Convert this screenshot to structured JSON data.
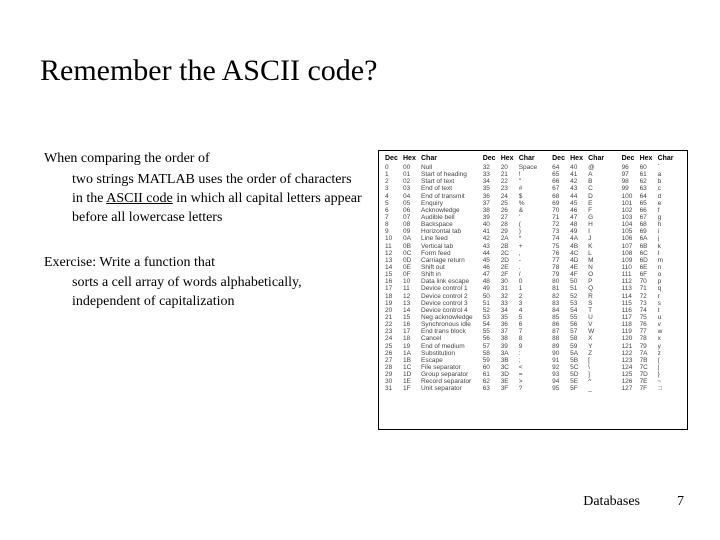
{
  "title": "Remember the ASCII code?",
  "para1": {
    "lead": "When comparing the order of",
    "rest": "two strings MATLAB uses the order of characters in the ",
    "link": "ASCII code",
    "tail": " in which all capital letters appear before all lowercase letters"
  },
  "para2": {
    "lead": "Exercise:  Write a function that",
    "rest": "sorts a cell array of words alphabetically, independent of capitalization"
  },
  "table_headers": [
    "Dec",
    "Hex",
    "Char"
  ],
  "ascii_cols": [
    [
      {
        "d": "0",
        "h": "00",
        "c": "Null"
      },
      {
        "d": "1",
        "h": "01",
        "c": "Start of heading"
      },
      {
        "d": "2",
        "h": "02",
        "c": "Start of text"
      },
      {
        "d": "3",
        "h": "03",
        "c": "End of text"
      },
      {
        "d": "4",
        "h": "04",
        "c": "End of transmit"
      },
      {
        "d": "5",
        "h": "05",
        "c": "Enquiry"
      },
      {
        "d": "6",
        "h": "06",
        "c": "Acknowledge"
      },
      {
        "d": "7",
        "h": "07",
        "c": "Audible bell"
      },
      {
        "d": "8",
        "h": "08",
        "c": "Backspace"
      },
      {
        "d": "9",
        "h": "09",
        "c": "Horizontal tab"
      },
      {
        "d": "10",
        "h": "0A",
        "c": "Line feed"
      },
      {
        "d": "11",
        "h": "0B",
        "c": "Vertical tab"
      },
      {
        "d": "12",
        "h": "0C",
        "c": "Form feed"
      },
      {
        "d": "13",
        "h": "0D",
        "c": "Carriage return"
      },
      {
        "d": "14",
        "h": "0E",
        "c": "Shift out"
      },
      {
        "d": "15",
        "h": "0F",
        "c": "Shift in"
      },
      {
        "d": "16",
        "h": "10",
        "c": "Data link escape"
      },
      {
        "d": "17",
        "h": "11",
        "c": "Device control 1"
      },
      {
        "d": "18",
        "h": "12",
        "c": "Device control 2"
      },
      {
        "d": "19",
        "h": "13",
        "c": "Device control 3"
      },
      {
        "d": "20",
        "h": "14",
        "c": "Device control 4"
      },
      {
        "d": "21",
        "h": "15",
        "c": "Neg acknowledge"
      },
      {
        "d": "22",
        "h": "16",
        "c": "Synchronous idle"
      },
      {
        "d": "23",
        "h": "17",
        "c": "End trans block"
      },
      {
        "d": "24",
        "h": "18",
        "c": "Cancel"
      },
      {
        "d": "25",
        "h": "19",
        "c": "End of medium"
      },
      {
        "d": "26",
        "h": "1A",
        "c": "Substitution"
      },
      {
        "d": "27",
        "h": "1B",
        "c": "Escape"
      },
      {
        "d": "28",
        "h": "1C",
        "c": "File separator"
      },
      {
        "d": "29",
        "h": "1D",
        "c": "Group separator"
      },
      {
        "d": "30",
        "h": "1E",
        "c": "Record separator"
      },
      {
        "d": "31",
        "h": "1F",
        "c": "Unit separator"
      }
    ],
    [
      {
        "d": "32",
        "h": "20",
        "c": "Space"
      },
      {
        "d": "33",
        "h": "21",
        "c": "!"
      },
      {
        "d": "34",
        "h": "22",
        "c": "\""
      },
      {
        "d": "35",
        "h": "23",
        "c": "#"
      },
      {
        "d": "36",
        "h": "24",
        "c": "$"
      },
      {
        "d": "37",
        "h": "25",
        "c": "%"
      },
      {
        "d": "38",
        "h": "26",
        "c": "&"
      },
      {
        "d": "39",
        "h": "27",
        "c": "'"
      },
      {
        "d": "40",
        "h": "28",
        "c": "("
      },
      {
        "d": "41",
        "h": "29",
        "c": ")"
      },
      {
        "d": "42",
        "h": "2A",
        "c": "*"
      },
      {
        "d": "43",
        "h": "2B",
        "c": "+"
      },
      {
        "d": "44",
        "h": "2C",
        "c": ","
      },
      {
        "d": "45",
        "h": "2D",
        "c": "-"
      },
      {
        "d": "46",
        "h": "2E",
        "c": "."
      },
      {
        "d": "47",
        "h": "2F",
        "c": "/"
      },
      {
        "d": "48",
        "h": "30",
        "c": "0"
      },
      {
        "d": "49",
        "h": "31",
        "c": "1"
      },
      {
        "d": "50",
        "h": "32",
        "c": "2"
      },
      {
        "d": "51",
        "h": "33",
        "c": "3"
      },
      {
        "d": "52",
        "h": "34",
        "c": "4"
      },
      {
        "d": "53",
        "h": "35",
        "c": "5"
      },
      {
        "d": "54",
        "h": "36",
        "c": "6"
      },
      {
        "d": "55",
        "h": "37",
        "c": "7"
      },
      {
        "d": "56",
        "h": "38",
        "c": "8"
      },
      {
        "d": "57",
        "h": "39",
        "c": "9"
      },
      {
        "d": "58",
        "h": "3A",
        "c": ":"
      },
      {
        "d": "59",
        "h": "3B",
        "c": ";"
      },
      {
        "d": "60",
        "h": "3C",
        "c": "<"
      },
      {
        "d": "61",
        "h": "3D",
        "c": "="
      },
      {
        "d": "62",
        "h": "3E",
        "c": ">"
      },
      {
        "d": "63",
        "h": "3F",
        "c": "?"
      }
    ],
    [
      {
        "d": "64",
        "h": "40",
        "c": "@"
      },
      {
        "d": "65",
        "h": "41",
        "c": "A"
      },
      {
        "d": "66",
        "h": "42",
        "c": "B"
      },
      {
        "d": "67",
        "h": "43",
        "c": "C"
      },
      {
        "d": "68",
        "h": "44",
        "c": "D"
      },
      {
        "d": "69",
        "h": "45",
        "c": "E"
      },
      {
        "d": "70",
        "h": "46",
        "c": "F"
      },
      {
        "d": "71",
        "h": "47",
        "c": "G"
      },
      {
        "d": "72",
        "h": "48",
        "c": "H"
      },
      {
        "d": "73",
        "h": "49",
        "c": "I"
      },
      {
        "d": "74",
        "h": "4A",
        "c": "J"
      },
      {
        "d": "75",
        "h": "4B",
        "c": "K"
      },
      {
        "d": "76",
        "h": "4C",
        "c": "L"
      },
      {
        "d": "77",
        "h": "4D",
        "c": "M"
      },
      {
        "d": "78",
        "h": "4E",
        "c": "N"
      },
      {
        "d": "79",
        "h": "4F",
        "c": "O"
      },
      {
        "d": "80",
        "h": "50",
        "c": "P"
      },
      {
        "d": "81",
        "h": "51",
        "c": "Q"
      },
      {
        "d": "82",
        "h": "52",
        "c": "R"
      },
      {
        "d": "83",
        "h": "53",
        "c": "S"
      },
      {
        "d": "84",
        "h": "54",
        "c": "T"
      },
      {
        "d": "85",
        "h": "55",
        "c": "U"
      },
      {
        "d": "86",
        "h": "56",
        "c": "V"
      },
      {
        "d": "87",
        "h": "57",
        "c": "W"
      },
      {
        "d": "88",
        "h": "58",
        "c": "X"
      },
      {
        "d": "89",
        "h": "59",
        "c": "Y"
      },
      {
        "d": "90",
        "h": "5A",
        "c": "Z"
      },
      {
        "d": "91",
        "h": "5B",
        "c": "["
      },
      {
        "d": "92",
        "h": "5C",
        "c": "\\"
      },
      {
        "d": "93",
        "h": "5D",
        "c": "]"
      },
      {
        "d": "94",
        "h": "5E",
        "c": "^"
      },
      {
        "d": "95",
        "h": "5F",
        "c": "_"
      }
    ],
    [
      {
        "d": "96",
        "h": "60",
        "c": "`"
      },
      {
        "d": "97",
        "h": "61",
        "c": "a"
      },
      {
        "d": "98",
        "h": "62",
        "c": "b"
      },
      {
        "d": "99",
        "h": "63",
        "c": "c"
      },
      {
        "d": "100",
        "h": "64",
        "c": "d"
      },
      {
        "d": "101",
        "h": "65",
        "c": "e"
      },
      {
        "d": "102",
        "h": "66",
        "c": "f"
      },
      {
        "d": "103",
        "h": "67",
        "c": "g"
      },
      {
        "d": "104",
        "h": "68",
        "c": "h"
      },
      {
        "d": "105",
        "h": "69",
        "c": "i"
      },
      {
        "d": "106",
        "h": "6A",
        "c": "j"
      },
      {
        "d": "107",
        "h": "6B",
        "c": "k"
      },
      {
        "d": "108",
        "h": "6C",
        "c": "l"
      },
      {
        "d": "109",
        "h": "6D",
        "c": "m"
      },
      {
        "d": "110",
        "h": "6E",
        "c": "n"
      },
      {
        "d": "111",
        "h": "6F",
        "c": "o"
      },
      {
        "d": "112",
        "h": "70",
        "c": "p"
      },
      {
        "d": "113",
        "h": "71",
        "c": "q"
      },
      {
        "d": "114",
        "h": "72",
        "c": "r"
      },
      {
        "d": "115",
        "h": "73",
        "c": "s"
      },
      {
        "d": "116",
        "h": "74",
        "c": "t"
      },
      {
        "d": "117",
        "h": "75",
        "c": "u"
      },
      {
        "d": "118",
        "h": "76",
        "c": "v"
      },
      {
        "d": "119",
        "h": "77",
        "c": "w"
      },
      {
        "d": "120",
        "h": "78",
        "c": "x"
      },
      {
        "d": "121",
        "h": "79",
        "c": "y"
      },
      {
        "d": "122",
        "h": "7A",
        "c": "z"
      },
      {
        "d": "123",
        "h": "7B",
        "c": "{"
      },
      {
        "d": "124",
        "h": "7C",
        "c": "|"
      },
      {
        "d": "125",
        "h": "7D",
        "c": "}"
      },
      {
        "d": "126",
        "h": "7E",
        "c": "~"
      },
      {
        "d": "127",
        "h": "7F",
        "c": "□"
      }
    ]
  ],
  "footer": {
    "label": "Databases",
    "page": "7"
  }
}
